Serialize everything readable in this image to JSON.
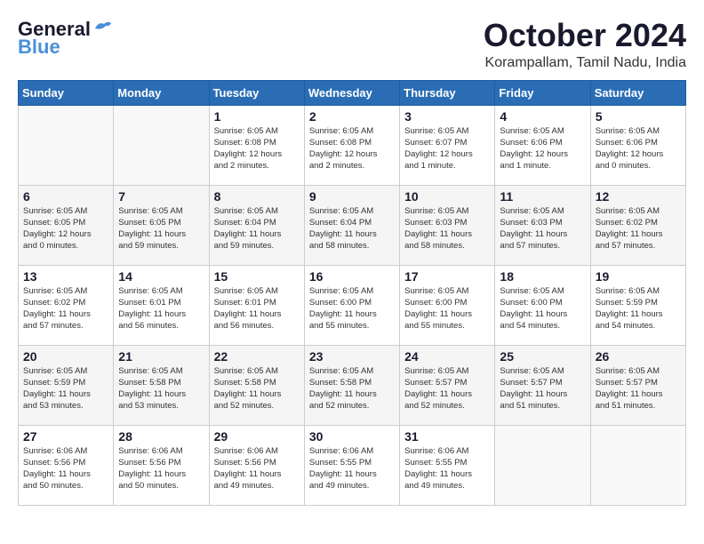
{
  "header": {
    "logo_general": "General",
    "logo_blue": "Blue",
    "month": "October 2024",
    "location": "Korampallam, Tamil Nadu, India"
  },
  "weekdays": [
    "Sunday",
    "Monday",
    "Tuesday",
    "Wednesday",
    "Thursday",
    "Friday",
    "Saturday"
  ],
  "weeks": [
    [
      {
        "day": "",
        "info": ""
      },
      {
        "day": "",
        "info": ""
      },
      {
        "day": "1",
        "info": "Sunrise: 6:05 AM\nSunset: 6:08 PM\nDaylight: 12 hours\nand 2 minutes."
      },
      {
        "day": "2",
        "info": "Sunrise: 6:05 AM\nSunset: 6:08 PM\nDaylight: 12 hours\nand 2 minutes."
      },
      {
        "day": "3",
        "info": "Sunrise: 6:05 AM\nSunset: 6:07 PM\nDaylight: 12 hours\nand 1 minute."
      },
      {
        "day": "4",
        "info": "Sunrise: 6:05 AM\nSunset: 6:06 PM\nDaylight: 12 hours\nand 1 minute."
      },
      {
        "day": "5",
        "info": "Sunrise: 6:05 AM\nSunset: 6:06 PM\nDaylight: 12 hours\nand 0 minutes."
      }
    ],
    [
      {
        "day": "6",
        "info": "Sunrise: 6:05 AM\nSunset: 6:05 PM\nDaylight: 12 hours\nand 0 minutes."
      },
      {
        "day": "7",
        "info": "Sunrise: 6:05 AM\nSunset: 6:05 PM\nDaylight: 11 hours\nand 59 minutes."
      },
      {
        "day": "8",
        "info": "Sunrise: 6:05 AM\nSunset: 6:04 PM\nDaylight: 11 hours\nand 59 minutes."
      },
      {
        "day": "9",
        "info": "Sunrise: 6:05 AM\nSunset: 6:04 PM\nDaylight: 11 hours\nand 58 minutes."
      },
      {
        "day": "10",
        "info": "Sunrise: 6:05 AM\nSunset: 6:03 PM\nDaylight: 11 hours\nand 58 minutes."
      },
      {
        "day": "11",
        "info": "Sunrise: 6:05 AM\nSunset: 6:03 PM\nDaylight: 11 hours\nand 57 minutes."
      },
      {
        "day": "12",
        "info": "Sunrise: 6:05 AM\nSunset: 6:02 PM\nDaylight: 11 hours\nand 57 minutes."
      }
    ],
    [
      {
        "day": "13",
        "info": "Sunrise: 6:05 AM\nSunset: 6:02 PM\nDaylight: 11 hours\nand 57 minutes."
      },
      {
        "day": "14",
        "info": "Sunrise: 6:05 AM\nSunset: 6:01 PM\nDaylight: 11 hours\nand 56 minutes."
      },
      {
        "day": "15",
        "info": "Sunrise: 6:05 AM\nSunset: 6:01 PM\nDaylight: 11 hours\nand 56 minutes."
      },
      {
        "day": "16",
        "info": "Sunrise: 6:05 AM\nSunset: 6:00 PM\nDaylight: 11 hours\nand 55 minutes."
      },
      {
        "day": "17",
        "info": "Sunrise: 6:05 AM\nSunset: 6:00 PM\nDaylight: 11 hours\nand 55 minutes."
      },
      {
        "day": "18",
        "info": "Sunrise: 6:05 AM\nSunset: 6:00 PM\nDaylight: 11 hours\nand 54 minutes."
      },
      {
        "day": "19",
        "info": "Sunrise: 6:05 AM\nSunset: 5:59 PM\nDaylight: 11 hours\nand 54 minutes."
      }
    ],
    [
      {
        "day": "20",
        "info": "Sunrise: 6:05 AM\nSunset: 5:59 PM\nDaylight: 11 hours\nand 53 minutes."
      },
      {
        "day": "21",
        "info": "Sunrise: 6:05 AM\nSunset: 5:58 PM\nDaylight: 11 hours\nand 53 minutes."
      },
      {
        "day": "22",
        "info": "Sunrise: 6:05 AM\nSunset: 5:58 PM\nDaylight: 11 hours\nand 52 minutes."
      },
      {
        "day": "23",
        "info": "Sunrise: 6:05 AM\nSunset: 5:58 PM\nDaylight: 11 hours\nand 52 minutes."
      },
      {
        "day": "24",
        "info": "Sunrise: 6:05 AM\nSunset: 5:57 PM\nDaylight: 11 hours\nand 52 minutes."
      },
      {
        "day": "25",
        "info": "Sunrise: 6:05 AM\nSunset: 5:57 PM\nDaylight: 11 hours\nand 51 minutes."
      },
      {
        "day": "26",
        "info": "Sunrise: 6:05 AM\nSunset: 5:57 PM\nDaylight: 11 hours\nand 51 minutes."
      }
    ],
    [
      {
        "day": "27",
        "info": "Sunrise: 6:06 AM\nSunset: 5:56 PM\nDaylight: 11 hours\nand 50 minutes."
      },
      {
        "day": "28",
        "info": "Sunrise: 6:06 AM\nSunset: 5:56 PM\nDaylight: 11 hours\nand 50 minutes."
      },
      {
        "day": "29",
        "info": "Sunrise: 6:06 AM\nSunset: 5:56 PM\nDaylight: 11 hours\nand 49 minutes."
      },
      {
        "day": "30",
        "info": "Sunrise: 6:06 AM\nSunset: 5:55 PM\nDaylight: 11 hours\nand 49 minutes."
      },
      {
        "day": "31",
        "info": "Sunrise: 6:06 AM\nSunset: 5:55 PM\nDaylight: 11 hours\nand 49 minutes."
      },
      {
        "day": "",
        "info": ""
      },
      {
        "day": "",
        "info": ""
      }
    ]
  ]
}
